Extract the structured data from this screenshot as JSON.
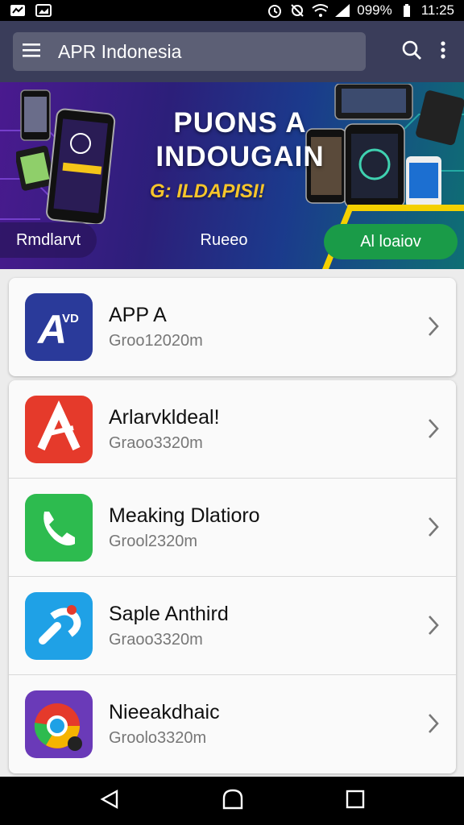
{
  "status_bar": {
    "battery_text": "099%",
    "time": "11:25"
  },
  "app_bar": {
    "title": "APR Indonesia",
    "menu_icon": "hamburger-menu-icon",
    "search_icon": "search-icon",
    "more_icon": "more-vertical-icon"
  },
  "banner": {
    "title_line1": "PUONS A",
    "title_line2": "INDOUGAIN",
    "subtitle": "G: ILDAPISI!",
    "tabs": [
      "Rmdlarvt",
      "Rueeo",
      "Al loaiov"
    ]
  },
  "apps": [
    {
      "name": "APP A",
      "sub": "Groo12020m",
      "icon": "app-a-icon",
      "color": "#2a3a9a"
    },
    {
      "name": "Arlarvkldeal!",
      "sub": "Graoo3320m",
      "icon": "red-a-icon",
      "color": "#e53a2b"
    },
    {
      "name": "Meaking Dlatioro",
      "sub": "Grool2320m",
      "icon": "phone-icon",
      "color": "#2dbb4f"
    },
    {
      "name": "Saple Anthird",
      "sub": "Graoo3320m",
      "icon": "link-icon",
      "color": "#1fa1e6"
    },
    {
      "name": "Nieeakdhaic",
      "sub": "Groolo3320m",
      "icon": "chrome-like-icon",
      "color": "#6a3ab8"
    }
  ],
  "nav_bar": {
    "back_icon": "back-triangle-icon",
    "home_icon": "home-icon",
    "recents_icon": "recents-square-icon"
  }
}
